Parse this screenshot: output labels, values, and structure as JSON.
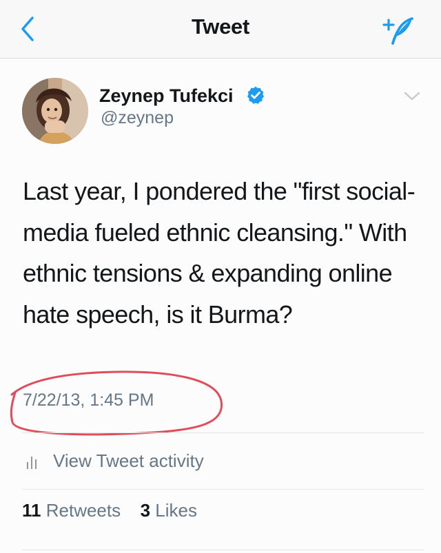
{
  "nav": {
    "title": "Tweet",
    "back_icon": "chevron-left-icon",
    "compose_icon": "compose-tweet-icon",
    "accent": "#1d9bf0"
  },
  "author": {
    "name": "Zeynep Tufekci",
    "handle": "@zeynep",
    "verified": true,
    "avatar": "profile-avatar"
  },
  "tweet": {
    "text": "Last year, I pondered the \"first social-media fueled ethnic cleansing.\" With ethnic tensions & expanding online hate speech, is it Burma?",
    "timestamp": "7/22/13, 1:45 PM"
  },
  "actions": {
    "activity_label": "View Tweet activity"
  },
  "stats": {
    "retweets_count": "11",
    "retweets_label": "Retweets",
    "likes_count": "3",
    "likes_label": "Likes"
  },
  "colors": {
    "text": "#14171a",
    "muted": "#657786",
    "annotation": "#e24b5a"
  }
}
